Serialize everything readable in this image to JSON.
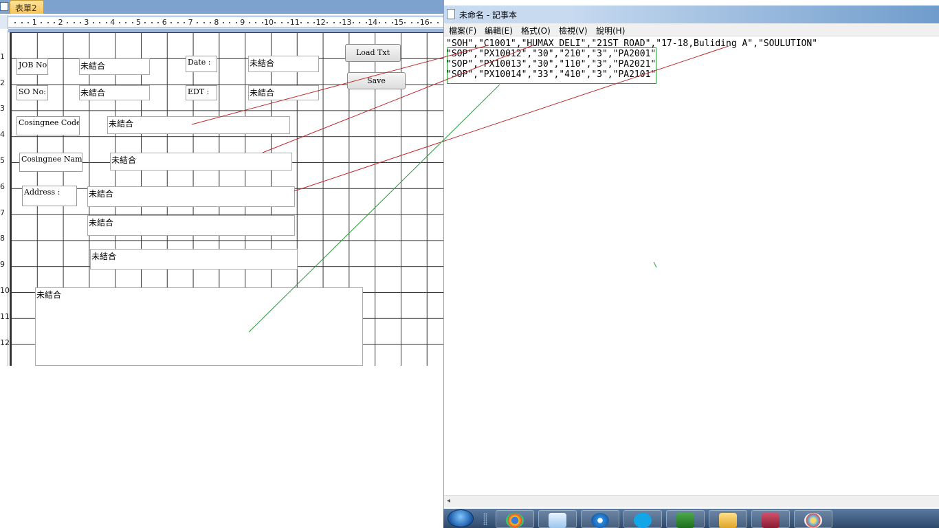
{
  "access": {
    "tab_label": "表單2",
    "ruler_numbers": [
      "1",
      "2",
      "3",
      "4",
      "5",
      "6",
      "7",
      "8",
      "9",
      "10",
      "11",
      "12",
      "13",
      "14",
      "15",
      "16"
    ],
    "vruler_numbers": [
      "1",
      "2",
      "3",
      "4",
      "5",
      "6",
      "7",
      "8",
      "9",
      "10",
      "11",
      "12"
    ],
    "labels": {
      "job_no": "JOB No:",
      "so_no": "SO No:",
      "date": "Date :",
      "edt": "EDT :",
      "consignee_code": "Cosingnee Code:",
      "consignee_name": "Cosingnee Name:",
      "address": "Address :"
    },
    "unbound": "未結合",
    "buttons": {
      "load": "Load Txt",
      "save": "Save"
    }
  },
  "notepad": {
    "title": "未命名 - 記事本",
    "menu": [
      "檔案(F)",
      "編輯(E)",
      "格式(O)",
      "檢視(V)",
      "說明(H)"
    ],
    "lines": [
      "\"SOH\",\"C1001\",\"HUMAX DELI\",\"21ST ROAD\",\"17-18,Buliding A\",\"SOULUTION\"",
      "\"SOP\",\"PX10012\",\"30\",\"210\",\"3\",\"PA2001\"",
      "\"SOP\",\"PX10013\",\"30\",\"110\",\"3\",\"PA2021\"",
      "\"SOP\",\"PX10014\",\"33\",\"410\",\"3\",\"PA2101\""
    ]
  },
  "taskbar": {
    "icons": [
      "chrome-icon",
      "notepad-icon",
      "ie-icon",
      "skype-icon",
      "excel-icon",
      "outlook-icon",
      "access-icon",
      "paint-icon"
    ]
  },
  "colors": {
    "annotation_red": "#c0282d",
    "annotation_green": "#2e9a3e",
    "grid": "#333333"
  }
}
